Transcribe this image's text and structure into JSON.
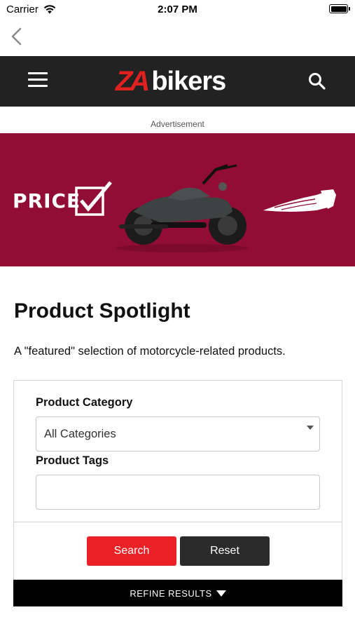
{
  "status_bar": {
    "carrier": "Carrier",
    "time": "2:07 PM"
  },
  "header": {
    "logo_mark": "ZA",
    "logo_text": "bikers",
    "accent_color": "#e1211f",
    "background_color": "#222222"
  },
  "ad": {
    "label": "Advertisement",
    "price_text": "PRICE",
    "background_color": "#920d36"
  },
  "page": {
    "title": "Product Spotlight",
    "description": "A \"featured\" selection of motorcycle-related products."
  },
  "filters": {
    "category_label": "Product Category",
    "category_selected": "All Categories",
    "tags_label": "Product Tags",
    "tags_value": "",
    "search_label": "Search",
    "reset_label": "Reset",
    "refine_label": "REFINE RESULTS"
  },
  "icons": {
    "back": "chevron-left-icon",
    "menu": "hamburger-menu-icon",
    "search": "search-icon",
    "wifi": "wifi-icon",
    "battery": "battery-icon"
  }
}
